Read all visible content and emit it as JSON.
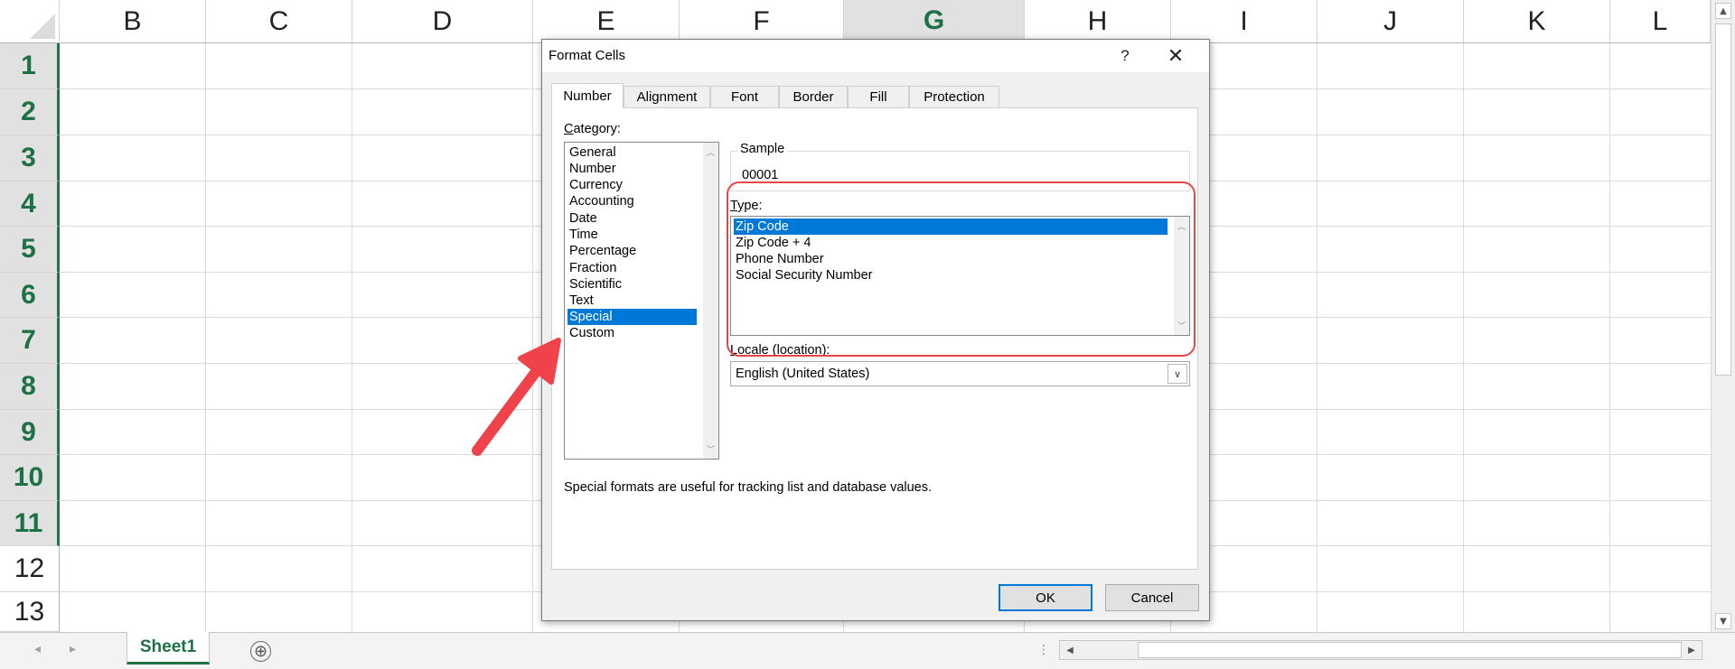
{
  "spreadsheet": {
    "columns": [
      "B",
      "C",
      "D",
      "E",
      "F",
      "G",
      "H",
      "I",
      "J",
      "K",
      "L"
    ],
    "selected_column": "G",
    "rows": [
      "1",
      "2",
      "3",
      "4",
      "5",
      "6",
      "7",
      "8",
      "9",
      "10",
      "11",
      "12",
      "13"
    ],
    "selected_rows": [
      "1",
      "2",
      "3",
      "4",
      "5",
      "6",
      "7",
      "8",
      "9",
      "10",
      "11"
    ]
  },
  "sheet_tabs": {
    "active": "Sheet1",
    "add_label": "⊕"
  },
  "dialog": {
    "title": "Format Cells",
    "help_label": "?",
    "close_label": "✕",
    "tabs": [
      {
        "label": "Number",
        "active": true
      },
      {
        "label": "Alignment",
        "active": false
      },
      {
        "label": "Font",
        "active": false
      },
      {
        "label": "Border",
        "active": false
      },
      {
        "label": "Fill",
        "active": false
      },
      {
        "label": "Protection",
        "active": false
      }
    ],
    "category_label_first": "C",
    "category_label_rest": "ategory:",
    "categories": [
      "General",
      "Number",
      "Currency",
      "Accounting",
      "Date",
      "Time",
      "Percentage",
      "Fraction",
      "Scientific",
      "Text",
      "Special",
      "Custom"
    ],
    "selected_category": "Special",
    "sample_label": "Sample",
    "sample_value": "00001",
    "type_label_first": "T",
    "type_label_rest": "ype:",
    "types": [
      "Zip Code",
      "Zip Code + 4",
      "Phone Number",
      "Social Security Number"
    ],
    "selected_type": "Zip Code",
    "locale_label_first": "L",
    "locale_label_rest": "ocale (location):",
    "locale_value": "English (United States)",
    "description": "Special formats are useful for tracking list and database values.",
    "ok_label": "OK",
    "cancel_label": "Cancel"
  },
  "annotation": {
    "highlight_color": "#e84646",
    "arrow_color": "#f0424a"
  },
  "colors": {
    "excel_green": "#217346",
    "selection_blue": "#0078d7"
  }
}
